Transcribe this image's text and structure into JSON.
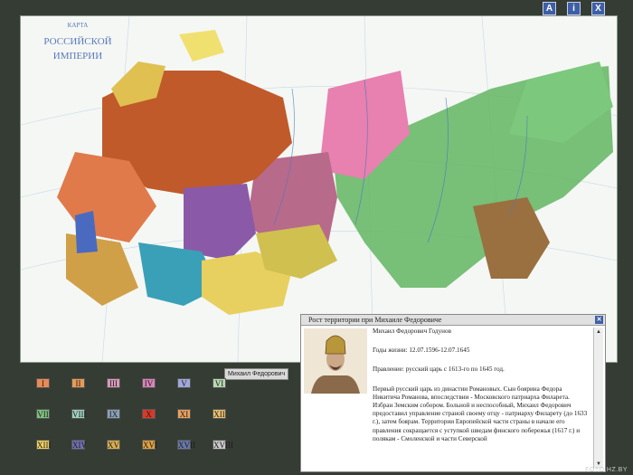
{
  "toolbar": {
    "btn_a": "A",
    "btn_info": "i",
    "btn_close": "X"
  },
  "map": {
    "title_small": "КАРТА",
    "title_line1": "РОССИЙСКОЙ",
    "title_line2": "ИМПЕРИИ"
  },
  "tooltip": "Михаил Федорович",
  "eras": [
    {
      "label": "I",
      "color": "#e88a55"
    },
    {
      "label": "II",
      "color": "#e89a55"
    },
    {
      "label": "III",
      "color": "#d89bb9"
    },
    {
      "label": "IV",
      "color": "#d883b9"
    },
    {
      "label": "V",
      "color": "#9fa8d8"
    },
    {
      "label": "VI",
      "color": "#b8d8b0"
    },
    {
      "label": "VII",
      "color": "#80c080"
    },
    {
      "label": "VIII",
      "color": "#a0d0c0"
    },
    {
      "label": "IX",
      "color": "#8aa0b8"
    },
    {
      "label": "X",
      "color": "#d83a2a"
    },
    {
      "label": "XI",
      "color": "#e8a060"
    },
    {
      "label": "XII",
      "color": "#e8c070"
    },
    {
      "label": "XIII",
      "color": "#f0d060"
    },
    {
      "label": "XIV",
      "color": "#7070b0"
    },
    {
      "label": "XV",
      "color": "#d8b050"
    },
    {
      "label": "XVI",
      "color": "#e0a040"
    },
    {
      "label": "XVII",
      "color": "#6878a8"
    },
    {
      "label": "XVIII",
      "color": "#c8c8c8"
    }
  ],
  "panel": {
    "title": "Рост территории при Михаиле Федоровиче",
    "name": "Михаил Федорович Годунов",
    "life": "Годы жизни: 12.07.1596-12.07.1645",
    "reign": "Правление: русский царь с 1613-го по 1645 год.",
    "bio": "Первый русский царь из династии Романовых. Сын боярина Федора Никитича Романова, впоследствии - Московского патриарха Филарета. Избран Земским собором. Больной и неспособный, Михаил Федорович предоставил управление страной своему отцу - патриарху Филарету (до 1633 г.), затем боярам. Территории Европейской части страны в начале его правления сокращается с уступкой шведам финского побережья (1617 г.) и полякам - Смоленской и части Северской"
  },
  "watermark": "FOTO.HZ.BY"
}
